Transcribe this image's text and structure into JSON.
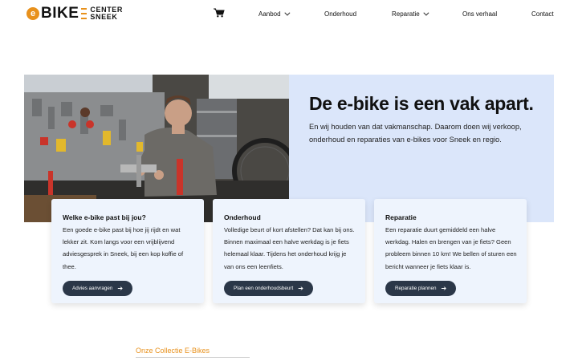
{
  "header": {
    "logo": {
      "e": "e",
      "bike": "BIKE",
      "center": "CENTER",
      "sneek": "SNEEK"
    },
    "cart_icon": "shopping-cart-icon",
    "nav": [
      {
        "label": "Aanbod",
        "dropdown": true
      },
      {
        "label": "Onderhoud",
        "dropdown": false
      },
      {
        "label": "Reparatie",
        "dropdown": true
      },
      {
        "label": "Ons verhaal",
        "dropdown": false
      },
      {
        "label": "Contact",
        "dropdown": false
      }
    ]
  },
  "hero": {
    "title": "De e-bike is een vak apart.",
    "subtitle": "En wij houden van dat vakmanschap. Daarom doen wij verkoop, onderhoud en reparaties van e-bikes voor Sneek en regio."
  },
  "cards": [
    {
      "title": "Welke e-bike past bij jou?",
      "text": "Een goede e-bike past bij hoe jij rijdt en wat lekker zit. Kom langs voor een vrijblijvend adviesgesprek in Sneek, bij een kop koffie of thee.",
      "button": "Advies aanvragen"
    },
    {
      "title": "Onderhoud",
      "text": "Volledige beurt of kort afstellen? Dat kan bij ons. Binnen maximaal een halve werkdag is je fiets helemaal klaar. Tijdens het onderhoud krijg je van ons een leenfiets.",
      "button": "Plan een onderhoudsbeurt"
    },
    {
      "title": "Reparatie",
      "text": "Een reparatie duurt gemiddeld een halve werkdag. Halen en brengen van je fiets? Geen probleem binnen 10 km! We bellen of sturen een bericht wanneer je fiets klaar is.",
      "button": "Reparatie plannen"
    }
  ],
  "collection": {
    "heading": "Onze Collectie E-Bikes"
  },
  "colors": {
    "accent": "#e8911c",
    "hero_bg": "#dbe6fa",
    "card_bg": "#eef4fd",
    "button": "#2b3748"
  }
}
